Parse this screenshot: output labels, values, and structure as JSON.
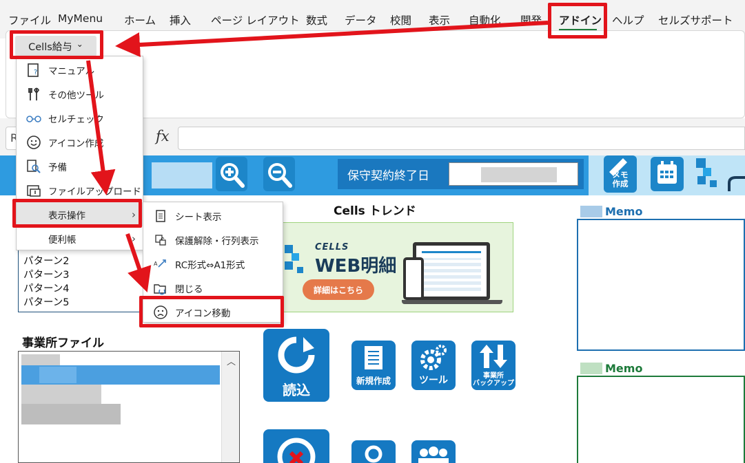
{
  "ribbon": {
    "tabs": [
      "ファイル",
      "MyMenu",
      "ホーム",
      "挿入",
      "ページ レイアウト",
      "数式",
      "データ",
      "校閲",
      "表示",
      "自動化",
      "開発",
      "アドイン",
      "ヘルプ",
      "セルズサポート"
    ],
    "active_tab": "アドイン",
    "addin_button": "Cells給与",
    "addin_button_chevron": "⌄"
  },
  "formula_bar": {
    "namebox": "R",
    "fx": "fx"
  },
  "menu": {
    "items": [
      {
        "label": "マニュアル",
        "icon": "manual-icon"
      },
      {
        "label": "その他ツール",
        "icon": "tools-icon"
      },
      {
        "label": "セルチェック",
        "icon": "glasses-icon"
      },
      {
        "label": "アイコン作成",
        "icon": "smiley-icon"
      },
      {
        "label": "予備",
        "icon": "search-person-icon"
      },
      {
        "label": "ファイルアップロード",
        "icon": "upload-icon"
      },
      {
        "label": "表示操作",
        "icon": "",
        "submenu": true
      },
      {
        "label": "便利帳",
        "icon": "",
        "submenu": true
      }
    ],
    "submenu": [
      {
        "label": "シート表示",
        "icon": "sheet-icon"
      },
      {
        "label": "保護解除・行列表示",
        "icon": "unlock-icon"
      },
      {
        "label": "RC形式⇔A1形式",
        "icon": "convert-icon"
      },
      {
        "label": "閉じる",
        "icon": "close-folder-icon"
      },
      {
        "label": "アイコン移動",
        "icon": "frown-icon"
      }
    ],
    "submenu_arrow": "›"
  },
  "banner": {
    "keiyaku_label": "保守契約終了日"
  },
  "sheet": {
    "trend_title": "Cells トレンド",
    "trend_banner": {
      "brand": "CELLS",
      "title": "WEB明細",
      "button": "詳細はこちら"
    },
    "patterns": [
      "パターン2",
      "パターン3",
      "パターン4",
      "パターン5"
    ],
    "jigyosho_title": "事業所ファイル",
    "memo1_title": "Memo",
    "memo2_title": "Memo",
    "buttons": {
      "read": "読込",
      "new": "新規作成",
      "tool": "ツール",
      "backup_line1": "事業所",
      "backup_line2": "バックアップ",
      "memo_line1": "メモ",
      "memo_line2": "作成"
    }
  },
  "colors": {
    "accent_red": "#e2141b",
    "banner_blue": "#2e9be0",
    "button_blue": "#1579c2",
    "memo1": "#1d6fb0",
    "memo2": "#1d7a3a",
    "active_tab_underline": "#1d7a3a"
  }
}
